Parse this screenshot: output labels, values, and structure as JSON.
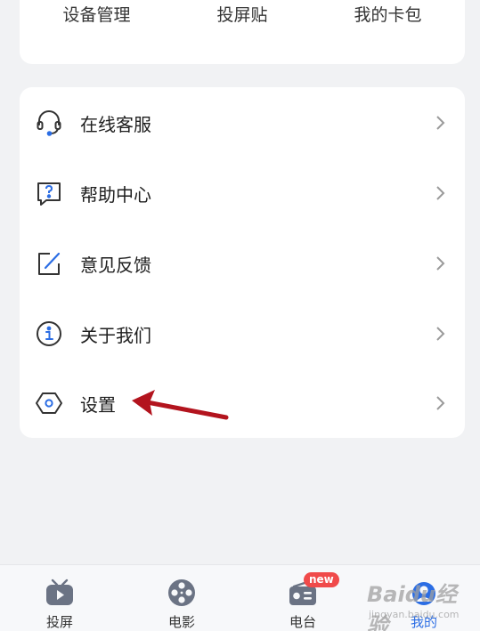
{
  "top_shortcuts": [
    {
      "label": "设备管理"
    },
    {
      "label": "投屏贴"
    },
    {
      "label": "我的卡包"
    }
  ],
  "menu": {
    "items": [
      {
        "label": "在线客服",
        "icon": "headset-icon"
      },
      {
        "label": "帮助中心",
        "icon": "help-question-icon"
      },
      {
        "label": "意见反馈",
        "icon": "edit-feedback-icon"
      },
      {
        "label": "关于我们",
        "icon": "info-icon"
      },
      {
        "label": "设置",
        "icon": "settings-hexagon-icon"
      }
    ]
  },
  "tabbar": {
    "tabs": [
      {
        "label": "投屏",
        "icon": "tv-cast-icon"
      },
      {
        "label": "电影",
        "icon": "film-reel-icon"
      },
      {
        "label": "电台",
        "icon": "radio-icon",
        "badge": "new"
      },
      {
        "label": "我的",
        "icon": "profile-icon",
        "active": true
      }
    ]
  },
  "watermark": {
    "main": "Baidu经验",
    "sub": "jingyan.baidu.com"
  },
  "colors": {
    "accent": "#2b6de4",
    "badge": "#f04a4a",
    "annotation_arrow": "#b3141e",
    "background": "#f1f2f4"
  }
}
